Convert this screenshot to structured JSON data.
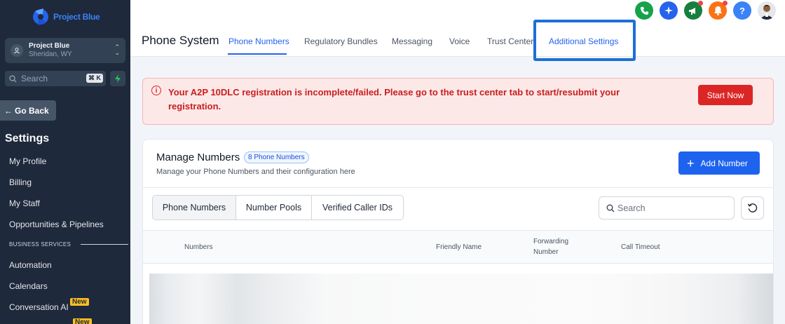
{
  "app": {
    "logo_text": "Project Blue"
  },
  "sidebar": {
    "account": {
      "name": "Project Blue",
      "location": "Sheridan, WY"
    },
    "search": {
      "placeholder": "Search",
      "shortcut": "⌘ K"
    },
    "go_back_label": "Go Back",
    "settings_title": "Settings",
    "items": [
      {
        "label": "My Profile"
      },
      {
        "label": "Billing"
      },
      {
        "label": "My Staff"
      },
      {
        "label": "Opportunities & Pipelines"
      }
    ],
    "section_label": "BUSINESS SERVICES",
    "section_items": [
      {
        "label": "Automation"
      },
      {
        "label": "Calendars"
      },
      {
        "label": "Conversation AI",
        "badge": "New"
      }
    ],
    "extra_badge": "New"
  },
  "topbar": {
    "icons": [
      "phone-icon",
      "sparkle-icon",
      "megaphone-icon",
      "bell-icon",
      "help-icon",
      "avatar"
    ],
    "help_glyph": "?",
    "colors": {
      "phone": "#16a34a",
      "sparkle": "#2563eb",
      "megaphone": "#15803d",
      "bell": "#f97316",
      "help": "#3b82f6"
    }
  },
  "header": {
    "title": "Phone System",
    "tabs": [
      {
        "label": "Phone Numbers",
        "active": true
      },
      {
        "label": "Regulatory Bundles"
      },
      {
        "label": "Messaging"
      },
      {
        "label": "Voice"
      },
      {
        "label": "Trust Center"
      },
      {
        "label": "Additional Settings",
        "highlighted": true
      }
    ]
  },
  "alert": {
    "message": "Your A2P 10DLC registration is incomplete/failed. Please go to the trust center tab to start/resubmit your registration.",
    "button_label": "Start Now"
  },
  "manage": {
    "title": "Manage Numbers",
    "count_badge": "8 Phone Numbers",
    "subtitle": "Manage your Phone Numbers and their configuration here",
    "add_button_label": "Add Number",
    "segments": [
      "Phone Numbers",
      "Number Pools",
      "Verified Caller IDs"
    ],
    "search_placeholder": "Search",
    "columns": [
      "Numbers",
      "Friendly Name",
      "Forwarding Number",
      "Call Timeout"
    ]
  }
}
